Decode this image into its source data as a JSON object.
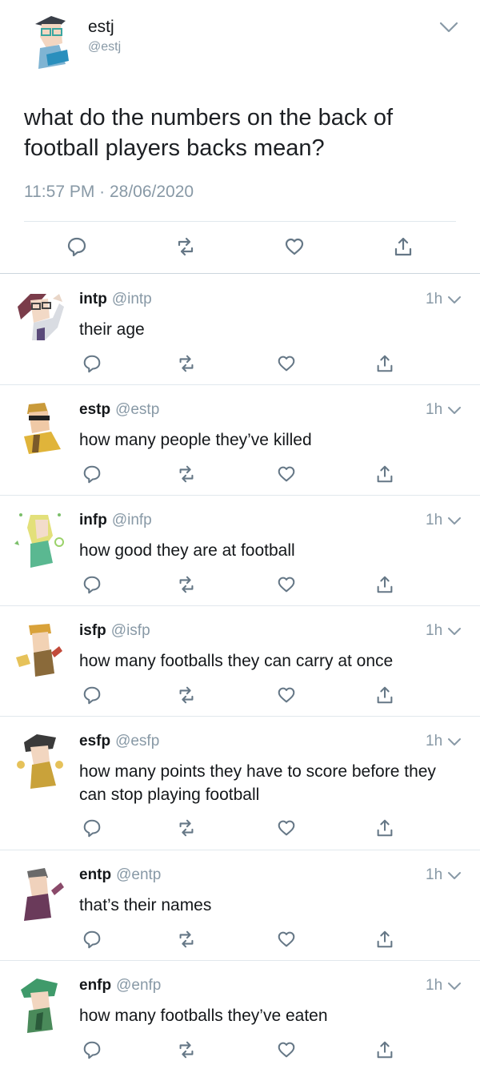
{
  "main_tweet": {
    "display_name": "estj",
    "handle": "@estj",
    "text": "what do the numbers on the back of football players backs mean?",
    "timestamp": "11:57 PM · 28/06/2020"
  },
  "replies": [
    {
      "name": "intp",
      "handle": "@intp",
      "time": "1h",
      "text": "their age"
    },
    {
      "name": "estp",
      "handle": "@estp",
      "time": "1h",
      "text": "how many people they’ve killed"
    },
    {
      "name": "infp",
      "handle": "@infp",
      "time": "1h",
      "text": "how good they are at football"
    },
    {
      "name": "isfp",
      "handle": "@isfp",
      "time": "1h",
      "text": "how many footballs they can carry at once"
    },
    {
      "name": "esfp",
      "handle": "@esfp",
      "time": "1h",
      "text": "how many points they have to score before they can stop playing football"
    },
    {
      "name": "entp",
      "handle": "@entp",
      "time": "1h",
      "text": "that’s their names"
    },
    {
      "name": "enfp",
      "handle": "@enfp",
      "time": "1h",
      "text": "how many footballs they’ve eaten"
    }
  ],
  "icons": {
    "reply": "speech-bubble-icon",
    "retweet": "retweet-icon",
    "like": "heart-icon",
    "share": "share-icon",
    "caret": "chevron-down-icon"
  },
  "colors": {
    "text": "#14171a",
    "secondary": "#8899a6",
    "icon": "#657786",
    "divider": "#e1e8ed"
  }
}
